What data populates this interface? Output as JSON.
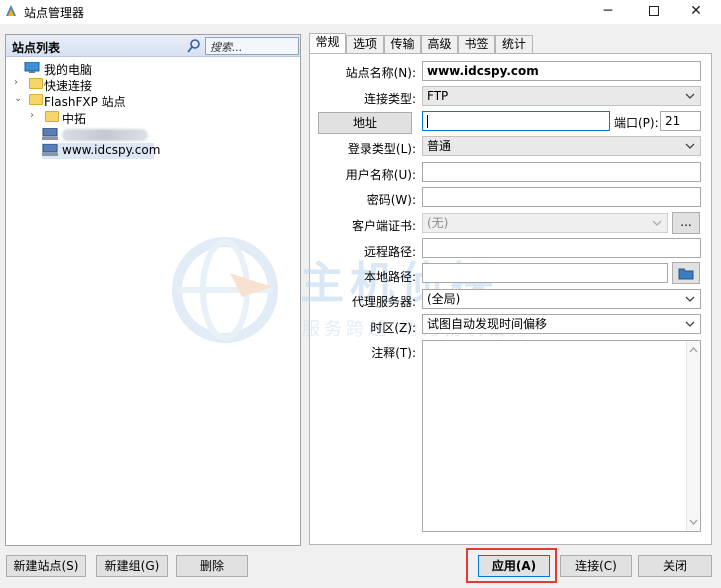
{
  "window": {
    "title": "站点管理器",
    "minimize": "─",
    "close": "✕"
  },
  "left": {
    "header_title": "站点列表",
    "search_placeholder": "搜索...",
    "tree": [
      {
        "label": "我的电脑",
        "icon": "computer-icon"
      },
      {
        "label": "快速连接",
        "icon": "folder-icon"
      },
      {
        "label": "FlashFXP 站点",
        "icon": "folder-icon"
      },
      {
        "label": "中拓",
        "icon": "folder-icon"
      },
      {
        "label": "",
        "icon": "server-icon"
      },
      {
        "label": "www.idcspy.com",
        "icon": "server-icon"
      }
    ]
  },
  "tabs": [
    "常规",
    "选项",
    "传输",
    "高级",
    "书签",
    "统计"
  ],
  "form": {
    "site_name_label": "站点名称(N):",
    "site_name_value": "www.idcspy.com",
    "conn_type_label": "连接类型:",
    "conn_type_value": "FTP",
    "address_button": "地址",
    "address_value": "",
    "port_label": "端口(P):",
    "port_value": "21",
    "login_type_label": "登录类型(L):",
    "login_type_value": "普通",
    "username_label": "用户名称(U):",
    "username_value": "",
    "password_label": "密码(W):",
    "password_value": "",
    "client_cert_label": "客户端证书:",
    "client_cert_value": "(无)",
    "browse_label": "...",
    "remote_path_label": "远程路径:",
    "remote_path_value": "",
    "local_path_label": "本地路径:",
    "local_path_value": "",
    "proxy_label": "代理服务器:",
    "proxy_value": "(全局)",
    "timezone_label": "时区(Z):",
    "timezone_value": "试图自动发现时间偏移",
    "notes_label": "注释(T):",
    "notes_value": ""
  },
  "watermark": {
    "text": "主机侦探",
    "sub": "服务跨越  助力扬帆出海"
  },
  "buttons": {
    "new_site": "新建站点(S)",
    "new_group": "新建组(G)",
    "delete": "删除",
    "apply": "应用(A)",
    "connect": "连接(C)",
    "close": "关闭"
  },
  "colors": {
    "accent": "#0078d7",
    "highlight": "#e53935",
    "folder": "#f7d56b"
  }
}
